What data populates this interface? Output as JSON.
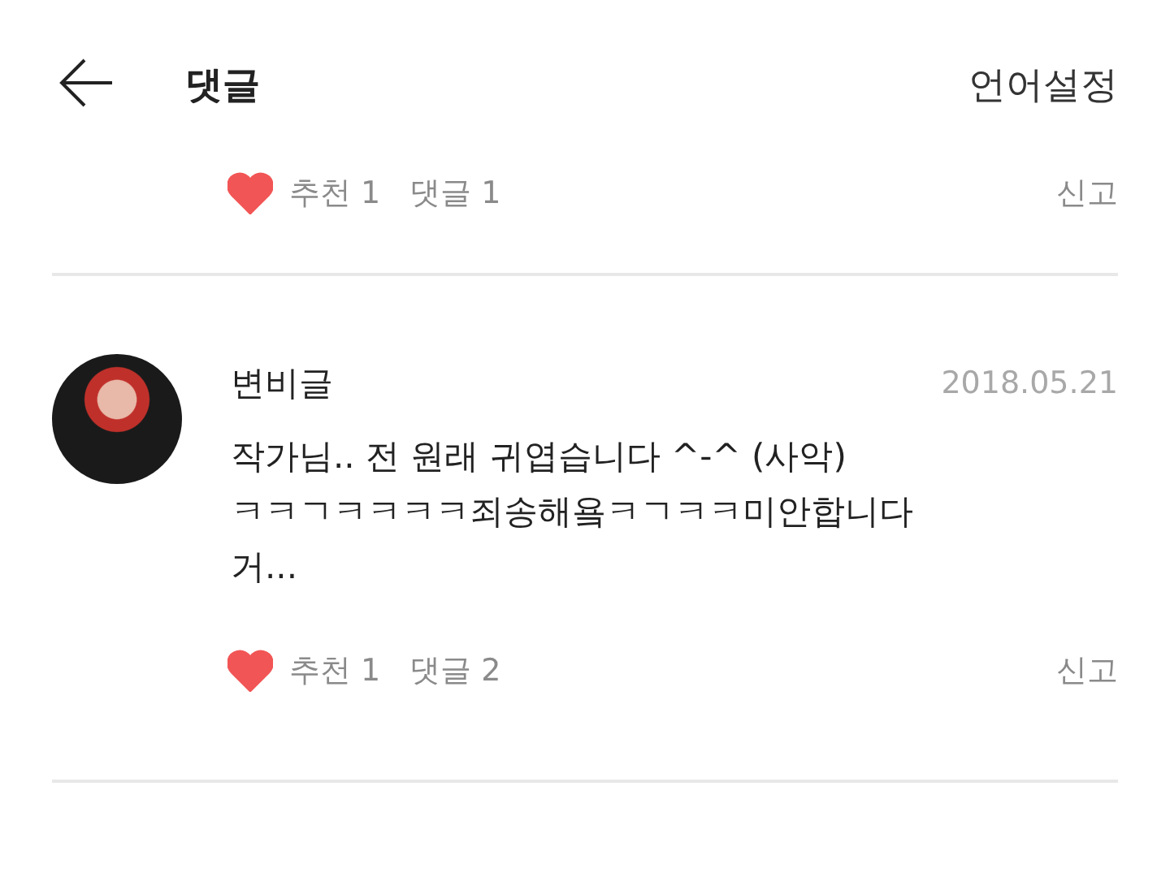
{
  "header": {
    "title": "댓글",
    "action": "언어설정"
  },
  "comments": [
    {
      "kind": "partial",
      "liked": true,
      "likes": "추천 1",
      "replies": "댓글 1",
      "report": "신고"
    },
    {
      "kind": "full",
      "author": "변비글",
      "date": "2018.05.21",
      "body": "작가님.. 전 원래 귀엽습니다 ^-^ (사악)\nㅋㅋㄱㅋㅋㅋㅋ죄송해욬ㅋㄱㅋㅋ미안합니다\n거...",
      "liked": true,
      "likes": "추천 1",
      "replies": "댓글 2",
      "report": "신고"
    }
  ]
}
